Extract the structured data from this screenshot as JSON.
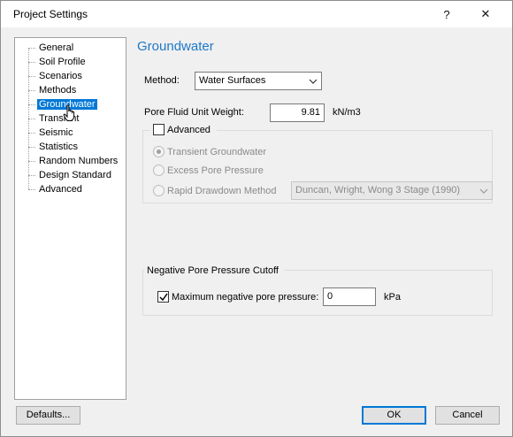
{
  "window": {
    "title": "Project Settings",
    "help_glyph": "?",
    "close_glyph": "✕"
  },
  "nav": {
    "items": [
      {
        "label": "General"
      },
      {
        "label": "Soil Profile"
      },
      {
        "label": "Scenarios"
      },
      {
        "label": "Methods"
      },
      {
        "label": "Groundwater",
        "selected": true
      },
      {
        "label": "Transient"
      },
      {
        "label": "Seismic"
      },
      {
        "label": "Statistics"
      },
      {
        "label": "Random Numbers"
      },
      {
        "label": "Design Standard"
      },
      {
        "label": "Advanced"
      }
    ]
  },
  "panel": {
    "title": "Groundwater",
    "method_label": "Method:",
    "method_value": "Water Surfaces",
    "unit_weight_label": "Pore Fluid Unit Weight:",
    "unit_weight_value": "9.81",
    "unit_weight_unit": "kN/m3",
    "advanced": {
      "label": "Advanced",
      "checked": false,
      "options": [
        {
          "label": "Transient Groundwater",
          "selected": true
        },
        {
          "label": "Excess Pore Pressure",
          "selected": false
        },
        {
          "label": "Rapid Drawdown Method",
          "selected": false
        }
      ],
      "drawdown_value": "Duncan, Wright, Wong 3 Stage (1990)"
    },
    "cutoff": {
      "group_label": "Negative Pore Pressure Cutoff",
      "checkbox_label": "Maximum negative pore pressure:",
      "checked": true,
      "value": "0",
      "unit": "kPa"
    }
  },
  "footer": {
    "defaults_label": "Defaults...",
    "ok_label": "OK",
    "cancel_label": "Cancel"
  }
}
